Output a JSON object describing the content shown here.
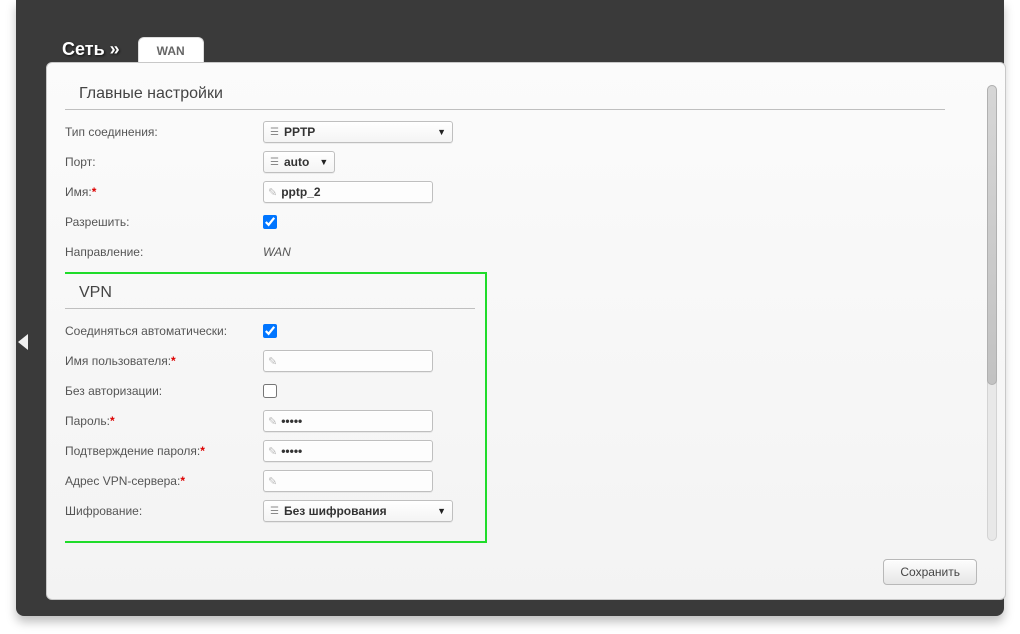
{
  "header": {
    "breadcrumb": "Сеть »",
    "tab": "WAN"
  },
  "sections": {
    "main_title": "Главные настройки",
    "vpn_title": "VPN"
  },
  "main": {
    "conn_type_label": "Тип соединения:",
    "conn_type_value": "PPTP",
    "port_label": "Порт:",
    "port_value": "auto",
    "name_label": "Имя:",
    "name_value": "pptp_2",
    "allow_label": "Разрешить:",
    "direction_label": "Направление:",
    "direction_value": "WAN"
  },
  "vpn": {
    "autoconnect_label": "Соединяться автоматически:",
    "username_label": "Имя пользователя:",
    "username_value": "",
    "noauth_label": "Без авторизации:",
    "password_label": "Пароль:",
    "password_value": "•••••",
    "password_confirm_label": "Подтверждение пароля:",
    "password_confirm_value": "•••••",
    "server_label": "Адрес VPN-сервера:",
    "server_value": "",
    "encryption_label": "Шифрование:",
    "encryption_value": "Без шифрования"
  },
  "buttons": {
    "save": "Сохранить"
  }
}
